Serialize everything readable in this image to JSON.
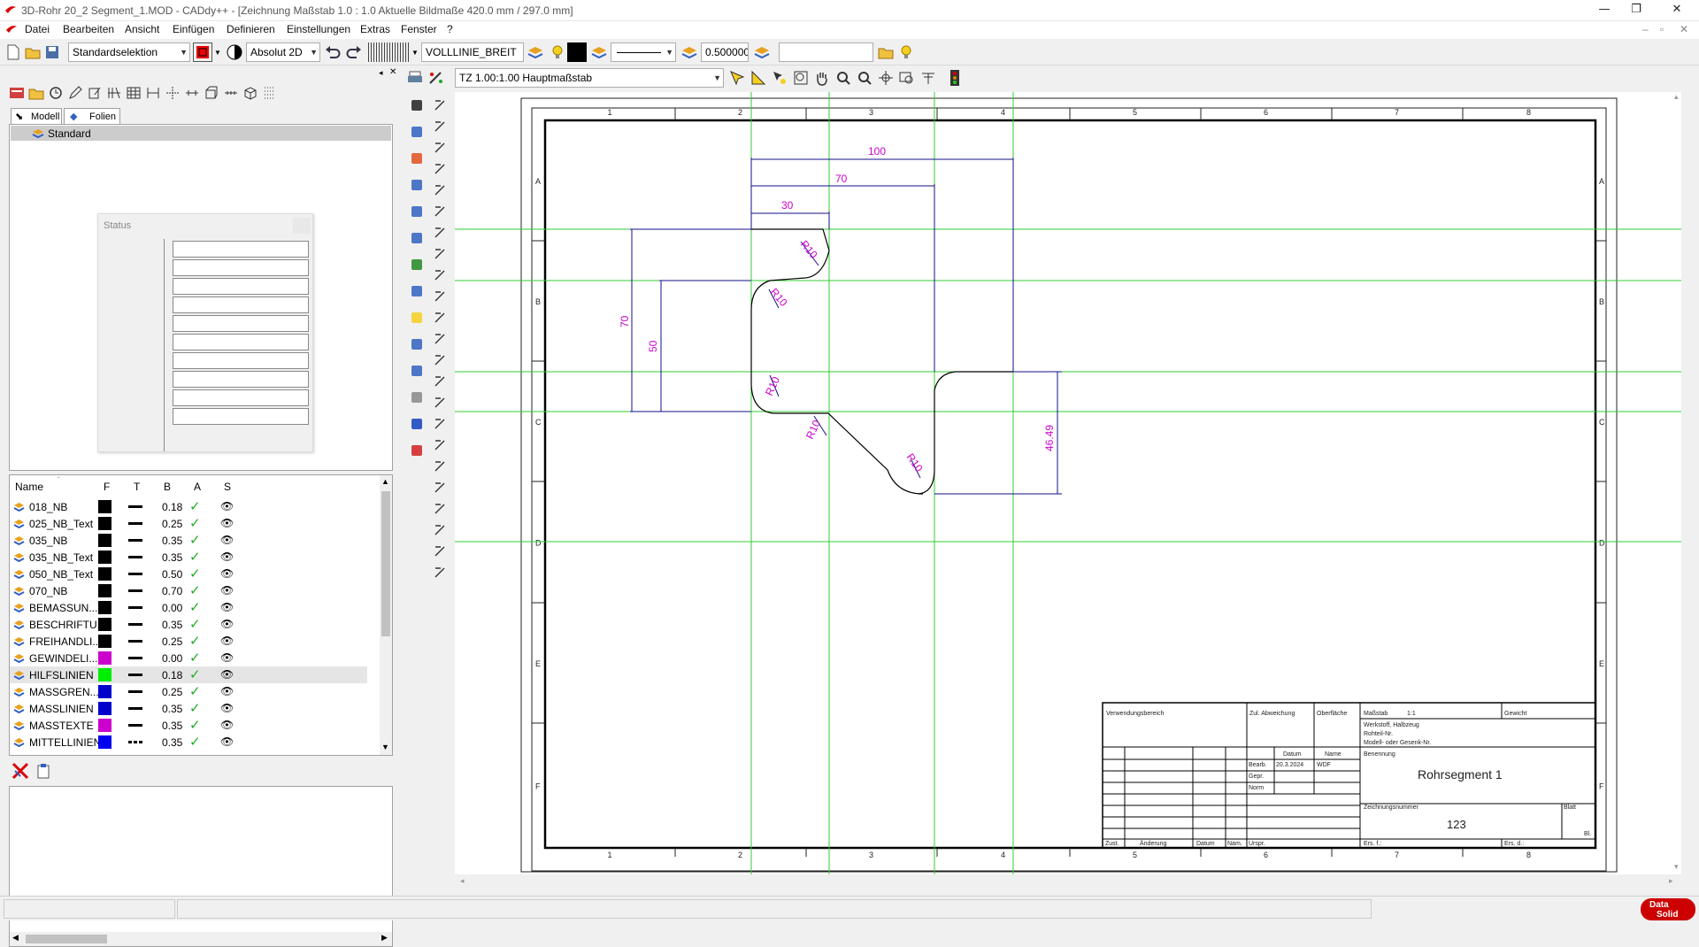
{
  "window": {
    "title": "3D-Rohr 20_2 Segment_1.MOD  - CADdy++ - [Zeichnung   Maßstab 1.0 : 1.0   Aktuelle Bildmaße 420.0 mm / 297.0 mm]",
    "minimize": "—",
    "maximize": "❐",
    "close": "✕"
  },
  "menu": {
    "items": [
      "Datei",
      "Bearbeiten",
      "Ansicht",
      "Einfügen",
      "Definieren",
      "Einstellungen",
      "Extras",
      "Fenster",
      "?"
    ]
  },
  "toolbar": {
    "selection_mode": "Standardselektion",
    "coord_mode": "Absolut 2D",
    "line_type_name": "VOLLLINIE_BREIT",
    "line_width": "0.500000",
    "text_field": ""
  },
  "view_toolbar": {
    "scale_combo": "TZ 1.00:1.00 Hauptmaßstab"
  },
  "left_panel": {
    "tabs": [
      "Modell",
      "Folien"
    ],
    "tree_root": "Standard",
    "status_dialog_title": "Status",
    "layer_columns": [
      "Name",
      "F",
      "T",
      "B",
      "A",
      "S"
    ],
    "layers": [
      {
        "name": "018_NB",
        "color": "#000000",
        "width": "0.18",
        "icon": "layer-icon"
      },
      {
        "name": "025_NB_Text",
        "color": "#000000",
        "width": "0.25",
        "icon": "layer-icon"
      },
      {
        "name": "035_NB",
        "color": "#000000",
        "width": "0.35",
        "icon": "layer-icon"
      },
      {
        "name": "035_NB_Text",
        "color": "#000000",
        "width": "0.35",
        "icon": "layer-icon"
      },
      {
        "name": "050_NB_Text",
        "color": "#000000",
        "width": "0.50",
        "icon": "layer-icon"
      },
      {
        "name": "070_NB",
        "color": "#000000",
        "width": "0.70",
        "icon": "layer-icon"
      },
      {
        "name": "BEMASSUN...",
        "color": "#000000",
        "width": "0.00",
        "icon": "dimension-icon"
      },
      {
        "name": "BESCHRIFTU...",
        "color": "#000000",
        "width": "0.35",
        "icon": "text-icon"
      },
      {
        "name": "FREIHANDLI...",
        "color": "#000000",
        "width": "0.25",
        "icon": "layer-icon"
      },
      {
        "name": "GEWINDELI...",
        "color": "#cc00cc",
        "width": "0.00",
        "icon": "thread-icon"
      },
      {
        "name": "HILFSLINIEN",
        "color": "#00ee00",
        "width": "0.18",
        "icon": "helpline-icon"
      },
      {
        "name": "MASSGREN...",
        "color": "#0000cc",
        "width": "0.25",
        "icon": "dimension-icon"
      },
      {
        "name": "MASSLINIEN",
        "color": "#0000cc",
        "width": "0.35",
        "icon": "dimension-icon"
      },
      {
        "name": "MASSTEXTE",
        "color": "#cc00cc",
        "width": "0.35",
        "icon": "dimension-icon"
      },
      {
        "name": "MITTELLINIEN",
        "color": "#0000ee",
        "width": "0.35",
        "icon": "centerline-icon"
      }
    ]
  },
  "drawing": {
    "col_labels": [
      "1",
      "2",
      "3",
      "4",
      "5",
      "6",
      "7",
      "8"
    ],
    "row_labels": [
      "A",
      "B",
      "C",
      "D",
      "E",
      "F"
    ],
    "dimensions": {
      "d100": "100",
      "d70_top": "70",
      "d30": "30",
      "d70_left": "70",
      "d50": "50",
      "d46": "46.49",
      "radius": "R10"
    },
    "title_block": {
      "verwendung": "Verwendungsbereich",
      "zul_abw": "Zul. Abweichung",
      "oberflaeche": "Oberfläche",
      "massstab": "Maßstab",
      "massstab_val": "1:1",
      "gewicht": "Gewicht",
      "werkstoff": "Werkstoff, Halbzeug",
      "rohteil": "Rohteil-Nr.",
      "modell": "Modell- oder Gesenk-Nr.",
      "datum": "Datum",
      "name": "Name",
      "bearb": "Bearb.",
      "bearb_date": "20.3.2024",
      "bearb_name": "WDF",
      "gepr": "Gepr.",
      "norm": "Norm",
      "benennung": "Benennung",
      "part_name": "Rohrsegment 1",
      "zeichnungsnummer": "Zeichnungsnummer",
      "drawing_number": "123",
      "blatt": "Blatt",
      "bl": "Bl.",
      "zust": "Zust.",
      "aenderung": "Änderung",
      "datum2": "Datum",
      "nam": "Nam.",
      "urspr": "Urspr.",
      "ers_f": "Ers. f.:",
      "ers_d": "Ers. d.:"
    }
  },
  "brand": {
    "logo_text_1": "Data",
    "logo_text_2": "Solid"
  }
}
